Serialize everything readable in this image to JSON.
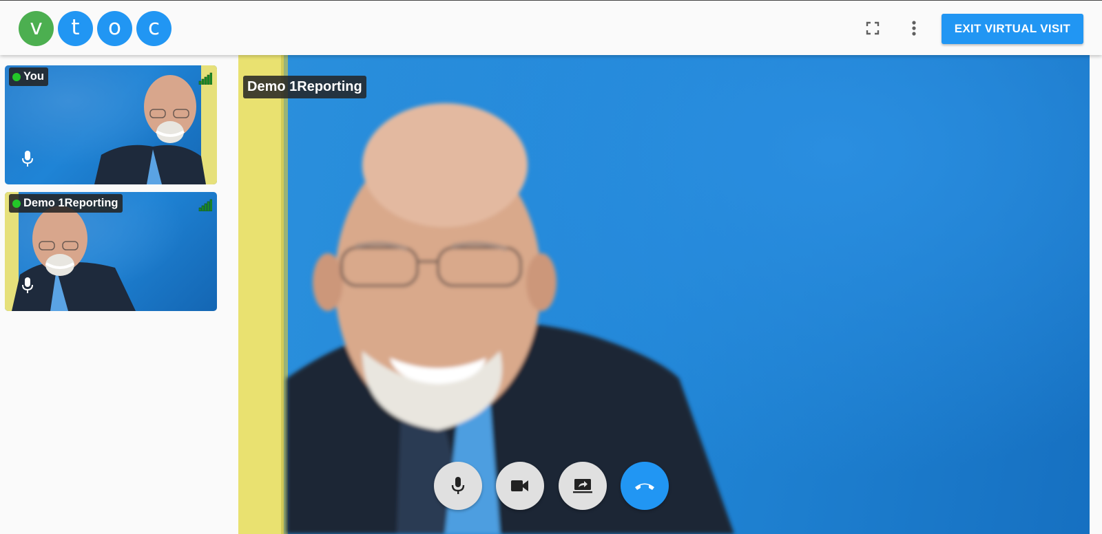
{
  "header": {
    "logo_letters": [
      "v",
      "t",
      "o",
      "c"
    ],
    "logo_colors": [
      "#4caf50",
      "#2196f3",
      "#2196f3",
      "#2196f3"
    ],
    "fullscreen_icon": "fullscreen-icon",
    "more_icon": "more-vert-icon",
    "exit_label": "EXIT VIRTUAL VISIT",
    "exit_color": "#2196f3"
  },
  "participants": [
    {
      "name": "You",
      "status_color": "#23c628",
      "signal_icon": "signal-bars-icon",
      "mic_icon": "mic-icon"
    },
    {
      "name": "Demo 1Reporting",
      "status_color": "#23c628",
      "signal_icon": "signal-bars-icon",
      "mic_icon": "mic-icon"
    }
  ],
  "main_video": {
    "speaker_label": "Demo 1Reporting"
  },
  "controls": [
    {
      "icon": "mic-icon",
      "color": "#e0e0e0"
    },
    {
      "icon": "videocam-icon",
      "color": "#e0e0e0"
    },
    {
      "icon": "screen-share-icon",
      "color": "#e0e0e0"
    },
    {
      "icon": "call-end-icon",
      "color": "#2196f3"
    }
  ]
}
